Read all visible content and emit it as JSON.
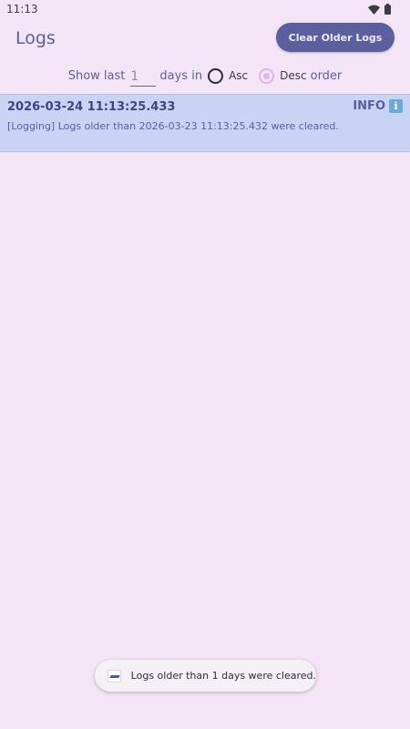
{
  "status_bar": {
    "time": "11:13"
  },
  "header": {
    "title": "Logs",
    "clear_button": "Clear Older Logs"
  },
  "filter": {
    "show_last_label": "Show last",
    "days_value": "1",
    "days_in_label": "days in",
    "asc_label": "Asc",
    "desc_label": "Desc",
    "order_label": "order",
    "selected_order": "Desc"
  },
  "logs": [
    {
      "timestamp": "2026-03-24 11:13:25.433",
      "level": "INFO",
      "message": "[Logging] Logs older than 2026-03-23 11:13:25.432 were cleared."
    }
  ],
  "toast": {
    "text": "Logs older than 1 days were cleared."
  },
  "colors": {
    "background": "#f3e5f5",
    "accent": "#5b5f9d",
    "log_row_bg": "#c9d4f4",
    "radio_selected": "#e0b3e9"
  }
}
